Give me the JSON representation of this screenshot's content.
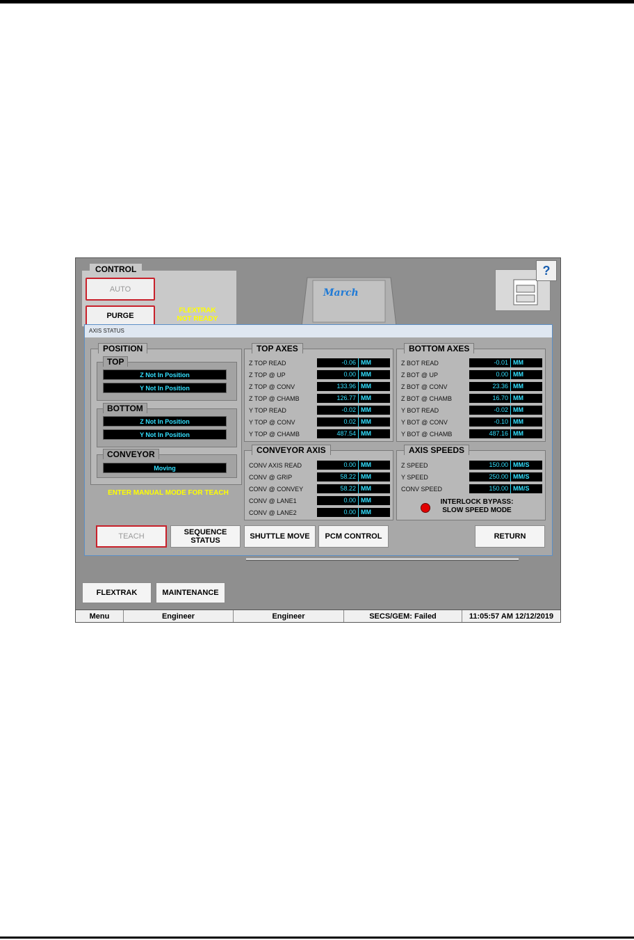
{
  "control": {
    "tab_label": "CONTROL",
    "auto_label": "AUTO",
    "purge_label": "PURGE",
    "flextrak_status": "FLEXTRAK NOT READY"
  },
  "machine": {
    "brand": "March"
  },
  "help_label": "?",
  "dialog": {
    "title": "AXIS STATUS",
    "position": {
      "title": "POSITION",
      "top_title": "TOP",
      "top_status": [
        "Z Not In Position",
        "Y Not In Position"
      ],
      "bottom_title": "BOTTOM",
      "bottom_status": [
        "Z Not In Position",
        "Y Not In Position"
      ],
      "conveyor_title": "CONVEYOR",
      "conveyor_status": "Moving"
    },
    "manual_hint": "ENTER MANUAL MODE FOR TEACH",
    "top_axes": {
      "title": "TOP AXES",
      "rows": [
        {
          "label": "Z TOP READ",
          "value": "-0.06",
          "unit": "MM"
        },
        {
          "label": "Z TOP @ UP",
          "value": "0.00",
          "unit": "MM"
        },
        {
          "label": "Z TOP @ CONV",
          "value": "133.96",
          "unit": "MM"
        },
        {
          "label": "Z TOP @ CHAMB",
          "value": "126.77",
          "unit": "MM"
        },
        {
          "label": "Y TOP READ",
          "value": "-0.02",
          "unit": "MM"
        },
        {
          "label": "Y TOP @ CONV",
          "value": "0.02",
          "unit": "MM"
        },
        {
          "label": "Y TOP @ CHAMB",
          "value": "487.54",
          "unit": "MM"
        }
      ]
    },
    "bottom_axes": {
      "title": "BOTTOM AXES",
      "rows": [
        {
          "label": "Z BOT READ",
          "value": "-0.01",
          "unit": "MM"
        },
        {
          "label": "Z BOT @ UP",
          "value": "0.00",
          "unit": "MM"
        },
        {
          "label": "Z BOT @ CONV",
          "value": "23.36",
          "unit": "MM"
        },
        {
          "label": "Z BOT @ CHAMB",
          "value": "16.70",
          "unit": "MM"
        },
        {
          "label": "Y BOT READ",
          "value": "-0.02",
          "unit": "MM"
        },
        {
          "label": "Y BOT @ CONV",
          "value": "-0.10",
          "unit": "MM"
        },
        {
          "label": "Y BOT @ CHAMB",
          "value": "487.16",
          "unit": "MM"
        }
      ]
    },
    "conveyor_axis": {
      "title": "CONVEYOR AXIS",
      "rows": [
        {
          "label": "CONV AXIS READ",
          "value": "0.00",
          "unit": "MM"
        },
        {
          "label": "CONV @ GRIP",
          "value": "58.22",
          "unit": "MM"
        },
        {
          "label": "CONV @ CONVEY",
          "value": "58.22",
          "unit": "MM"
        },
        {
          "label": "CONV @ LANE1",
          "value": "0.00",
          "unit": "MM"
        },
        {
          "label": "CONV @ LANE2",
          "value": "0.00",
          "unit": "MM"
        }
      ]
    },
    "axis_speeds": {
      "title": "AXIS SPEEDS",
      "rows": [
        {
          "label": "Z SPEED",
          "value": "150.00",
          "unit": "MM/S"
        },
        {
          "label": "Y SPEED",
          "value": "250.00",
          "unit": "MM/S"
        },
        {
          "label": "CONV SPEED",
          "value": "150.00",
          "unit": "MM/S"
        }
      ],
      "interlock_line1": "INTERLOCK BYPASS:",
      "interlock_line2": "SLOW SPEED MODE",
      "interlock_color": "#e20000"
    },
    "buttons": {
      "teach": "TEACH",
      "sequence_status_line1": "SEQUENCE",
      "sequence_status_line2": "STATUS",
      "shuttle_move": "SHUTTLE MOVE",
      "pcm_control": "PCM CONTROL",
      "return": "RETURN"
    }
  },
  "bottom_buttons": {
    "flextrak": "FLEXTRAK",
    "maintenance": "MAINTENANCE"
  },
  "statusbar": {
    "menu": "Menu",
    "user1": "Engineer",
    "user2": "Engineer",
    "secs": "SECS/GEM: Failed",
    "datetime": "11:05:57 AM 12/12/2019"
  }
}
